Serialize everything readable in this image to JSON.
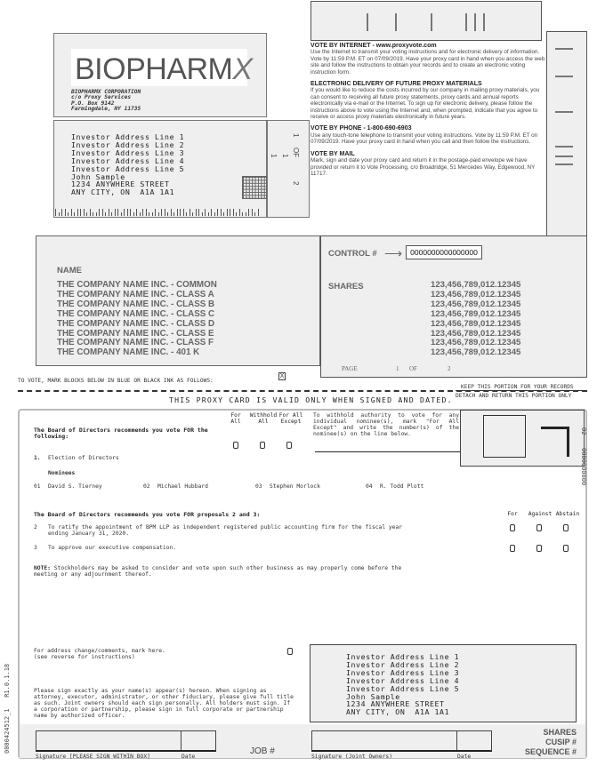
{
  "company": {
    "logo_text_1": "BIO",
    "logo_text_2": "PHARM",
    "logo_text_3": "X",
    "name_line": "BIOPHARMX CORPORATION",
    "address_lines": [
      "c/o Proxy Services",
      "P.O. Box 9142",
      "Farmingdale, NY 11735"
    ]
  },
  "investor": {
    "address_block": "Investor Address Line 1\nInvestor Address Line 2\nInvestor Address Line 3\nInvestor Address Line 4\nInvestor Address Line 5\nJohn Sample\n1234 ANYWHERE STREET\nANY CITY, ON  A1A 1A1"
  },
  "page_strip": {
    "page": "1",
    "of": "OF",
    "total": "2",
    "marks": [
      "1",
      "1"
    ]
  },
  "vote_info": {
    "internet_title": "VOTE BY INTERNET - www.proxyvote.com",
    "internet_text": "Use the Internet to transmit your voting instructions and for electronic delivery of information. Vote by 11:59 P.M. ET on 07/09/2019. Have your proxy card in hand when you access the web site and follow the instructions to obtain your records and to create an electronic voting instruction form.",
    "edelivery_title": "ELECTRONIC DELIVERY OF FUTURE PROXY MATERIALS",
    "edelivery_text": "If you would like to reduce the costs incurred by our company in mailing proxy materials, you can consent to receiving all future proxy statements, proxy cards and annual reports electronically via e-mail or the Internet. To sign up for electronic delivery, please follow the instructions above to vote using the Internet and, when prompted, indicate that you agree to receive or access proxy materials electronically in future years.",
    "phone_title": "VOTE BY PHONE - 1-800-690-6903",
    "phone_text": "Use any touch-tone telephone to transmit your voting instructions. Vote by 11:59 P.M. ET on 07/09/2019. Have your proxy card in hand when you call and then follow the instructions.",
    "mail_title": "VOTE BY MAIL",
    "mail_text": "Mark, sign and date your proxy card and return it in the postage-paid envelope we have provided or return it to Vote Processing, c/o Broadridge, 51 Mercedes Way, Edgewood, NY 11717."
  },
  "holdings": {
    "name_label": "NAME",
    "names": [
      "THE COMPANY NAME INC. - COMMON",
      "THE COMPANY NAME INC. - CLASS A",
      "THE COMPANY NAME INC. - CLASS B",
      "THE COMPANY NAME INC. - CLASS C",
      "THE COMPANY NAME INC. - CLASS D",
      "THE COMPANY NAME INC. - CLASS E",
      "THE COMPANY NAME INC. - CLASS F",
      "THE COMPANY NAME INC. - 401 K"
    ],
    "control_label": "CONTROL #",
    "control_arrow": "⟶",
    "control_number": "0000000000000000",
    "shares_label": "SHARES",
    "shares": [
      "123,456,789,012.12345",
      "123,456,789,012.12345",
      "123,456,789,012.12345",
      "123,456,789,012.12345",
      "123,456,789,012.12345",
      "123,456,789,012.12345",
      "123,456,789,012.12345",
      "123,456,789,012.12345"
    ],
    "page_label": "PAGE",
    "page_num": "1",
    "page_of": "OF",
    "page_total": "2"
  },
  "instructions": {
    "mark_text": "TO VOTE, MARK BLOCKS BELOW IN BLUE OR BLACK INK AS FOLLOWS:",
    "mark_example": "X",
    "keep_portion": "KEEP THIS PORTION FOR YOUR RECORDS",
    "valid_only": "THIS PROXY CARD IS VALID ONLY WHEN SIGNED AND DATED.",
    "detach_return": "DETACH AND RETURN THIS PORTION ONLY"
  },
  "ballot": {
    "recommend_1": "The Board of Directors recommends you vote FOR the following:",
    "col_for_all": "For All",
    "col_withhold_all": "Withhold All",
    "col_for_all_except": "For All Except",
    "withhold_text": "To withhold authority to vote for any individual nominee(s), mark \"For All Except\" and write the number(s) of the nominee(s) on the line below.",
    "item1_num": "1.",
    "item1_label": "Election of Directors",
    "nominees_label": "Nominees",
    "nominees": [
      {
        "num": "01",
        "name": "David S. Tierney"
      },
      {
        "num": "02",
        "name": "Michael Hubbard"
      },
      {
        "num": "03",
        "name": "Stephen Morlock"
      },
      {
        "num": "04",
        "name": "R. Todd Plott"
      }
    ],
    "recommend_2": "The Board of Directors recommends you vote FOR proposals 2 and 3:",
    "col_for": "For",
    "col_against": "Against",
    "col_abstain": "Abstain",
    "proposals": [
      {
        "num": "2",
        "text": "To ratify the appointment of BPM LLP as independent registered public accounting firm for the fiscal year ending January 31, 2020."
      },
      {
        "num": "3",
        "text": "To approve our executive compensation."
      }
    ],
    "note_label": "NOTE:",
    "note_text": " Stockholders may be asked to consider and vote upon such other business as may properly come before the meeting or any adjournment thereof.",
    "address_change": "For address change/comments, mark here.\n(see reverse for instructions)",
    "sign_text": "Please sign exactly as your name(s) appear(s) hereon. When signing as attorney, executor, administrator, or other fiduciary, please give full title as such. Joint owners should each sign personally. All holders must sign. If a corporation or partnership, please sign in full corporate or partnership name by authorized officer.",
    "side_code_1": "02",
    "side_code_2": "0000000000",
    "vertical_code": "0000424512_1   R1.0.1.18"
  },
  "signature": {
    "sig_label": "Signature [PLEASE SIGN WITHIN BOX]",
    "date_label": "Date",
    "job_label": "JOB #",
    "joint_label": "Signature (Joint Owners)",
    "date_label_2": "Date",
    "shares_label": "SHARES",
    "cusip_label": "CUSIP #",
    "sequence_label": "SEQUENCE #"
  }
}
